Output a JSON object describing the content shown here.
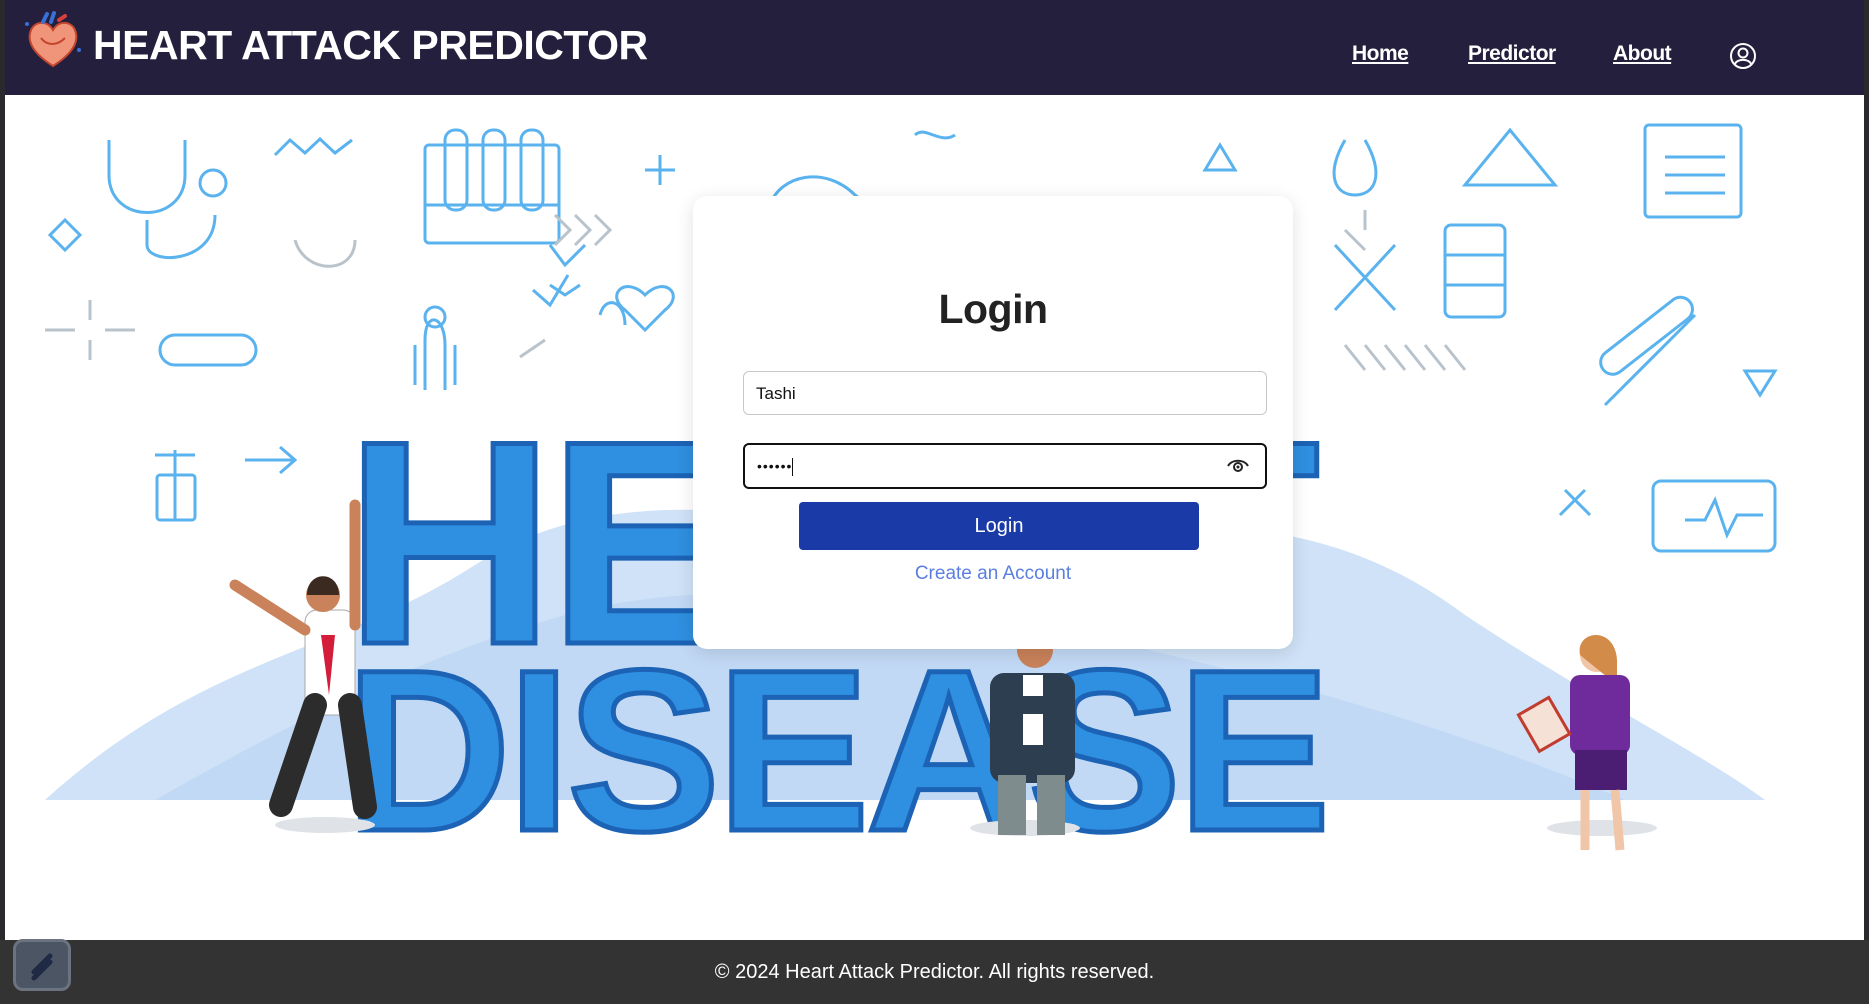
{
  "header": {
    "title": "HEART ATTACK PREDICTOR",
    "nav": {
      "home": "Home",
      "predictor": "Predictor",
      "about": "About"
    }
  },
  "hero": {
    "word1": "HEART",
    "word2": "DISEASE"
  },
  "login": {
    "title": "Login",
    "username_value": "Tashi",
    "password_value": "••••••",
    "button": "Login",
    "create_account": "Create an Account"
  },
  "footer": {
    "text": "© 2024 Heart Attack Predictor. All rights reserved."
  },
  "colors": {
    "header_bg": "#231f3d",
    "primary": "#1a3aa8",
    "link": "#5a7fe0",
    "illustration_blue": "#2f8fe0"
  },
  "icons": [
    "heart-logo-icon",
    "user-circle-icon",
    "eye-icon",
    "widget-icon"
  ]
}
